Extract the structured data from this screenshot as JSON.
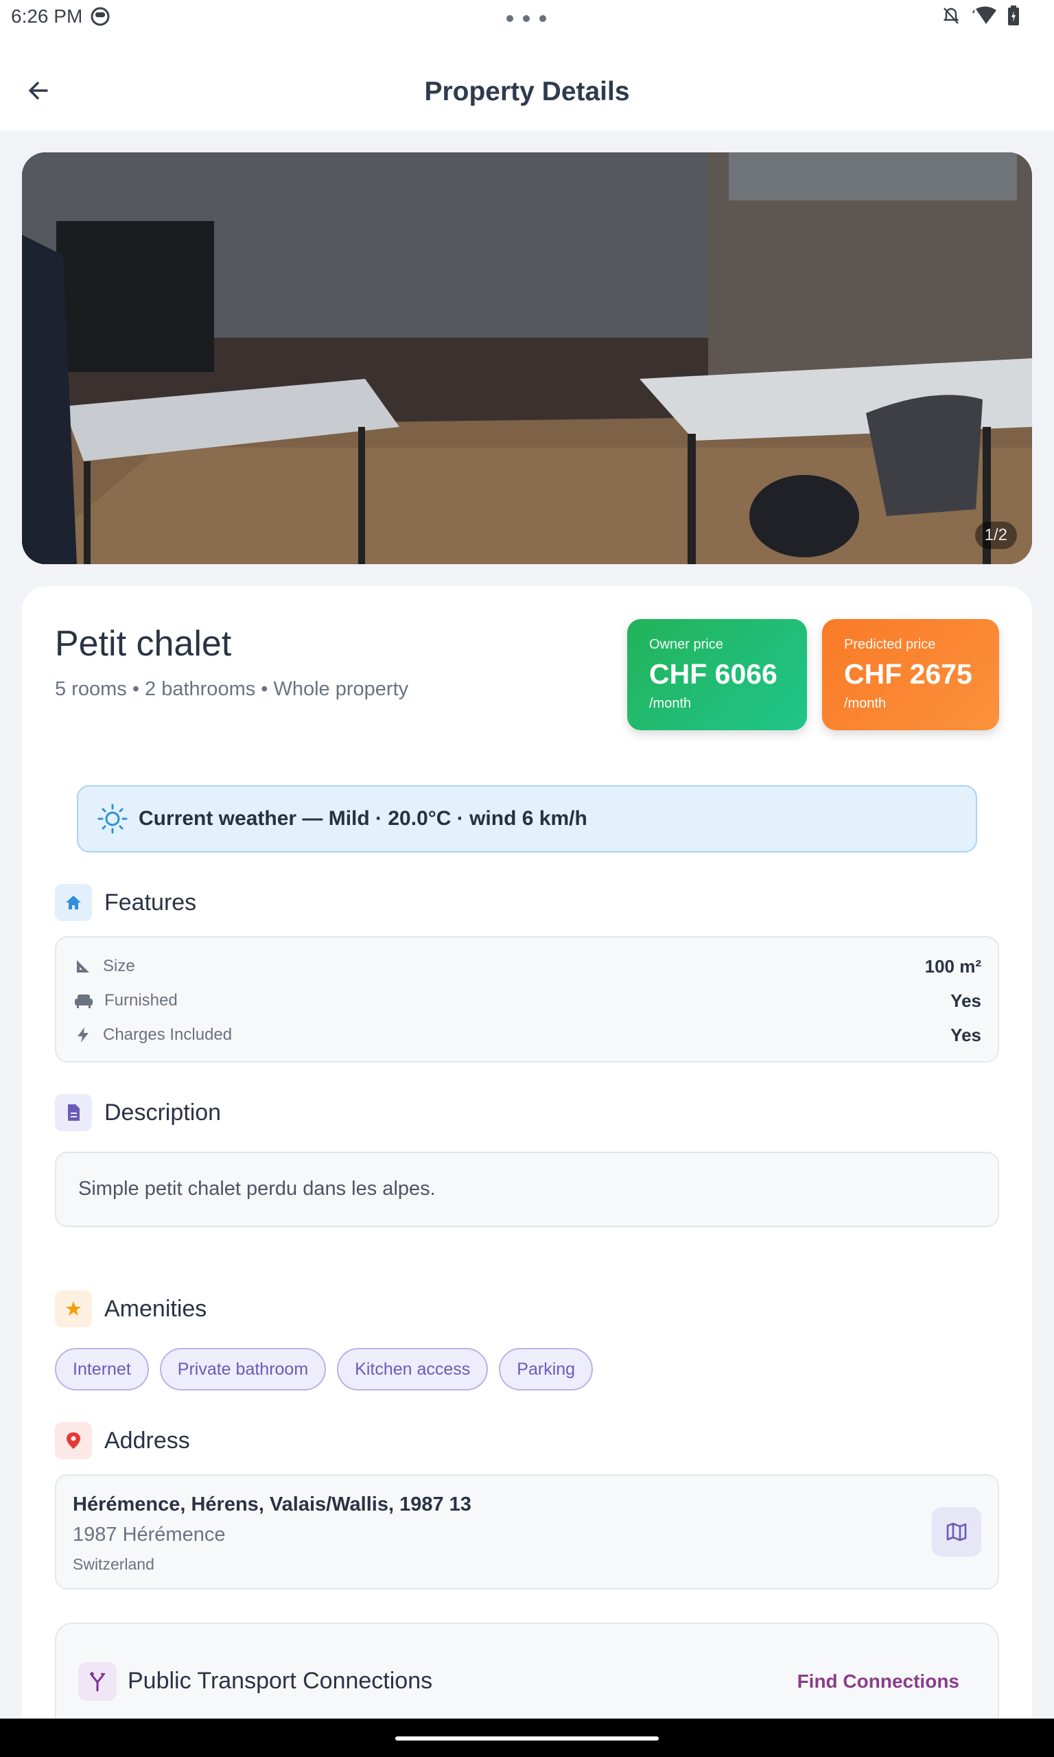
{
  "status_bar": {
    "time": "6:26 PM",
    "icons": [
      "face-icon",
      "notifications-off-icon",
      "wifi-icon",
      "battery-icon"
    ]
  },
  "header": {
    "title": "Property Details",
    "back_icon": "arrow-left-icon"
  },
  "hero": {
    "counter": "1/2"
  },
  "property": {
    "name": "Petit chalet",
    "subtitle": "5 rooms • 2 bathrooms • Whole property"
  },
  "prices": {
    "owner": {
      "label": "Owner price",
      "value": "CHF 6066",
      "unit": "/month",
      "color": "#22b35a"
    },
    "predicted": {
      "label": "Predicted price",
      "value": "CHF 2675",
      "unit": "/month",
      "color": "#f97a27"
    }
  },
  "weather": {
    "text": "Current weather — Mild · 20.0°C · wind 6 km/h",
    "icon": "sun-icon"
  },
  "features": {
    "title": "Features",
    "rows": [
      {
        "icon": "ruler-triangle-icon",
        "label": "Size",
        "value": "100 m²"
      },
      {
        "icon": "sofa-icon",
        "label": "Furnished",
        "value": "Yes"
      },
      {
        "icon": "lightning-icon",
        "label": "Charges Included",
        "value": "Yes"
      }
    ]
  },
  "description": {
    "title": "Description",
    "text": "Simple petit chalet perdu dans les alpes."
  },
  "amenities": {
    "title": "Amenities",
    "items": [
      "Internet",
      "Private bathroom",
      "Kitchen access",
      "Parking"
    ]
  },
  "address": {
    "title": "Address",
    "line1": "Hérémence, Hérens, Valais/Wallis, 1987 13",
    "line2": "1987 Hérémence",
    "line3": "Switzerland"
  },
  "transport": {
    "title": "Public Transport Connections",
    "link": "Find Connections"
  },
  "colors": {
    "accent_purple": "#6b5bb8",
    "weather_bg": "#e3f1fc",
    "link_purple": "#8a3d8a"
  }
}
